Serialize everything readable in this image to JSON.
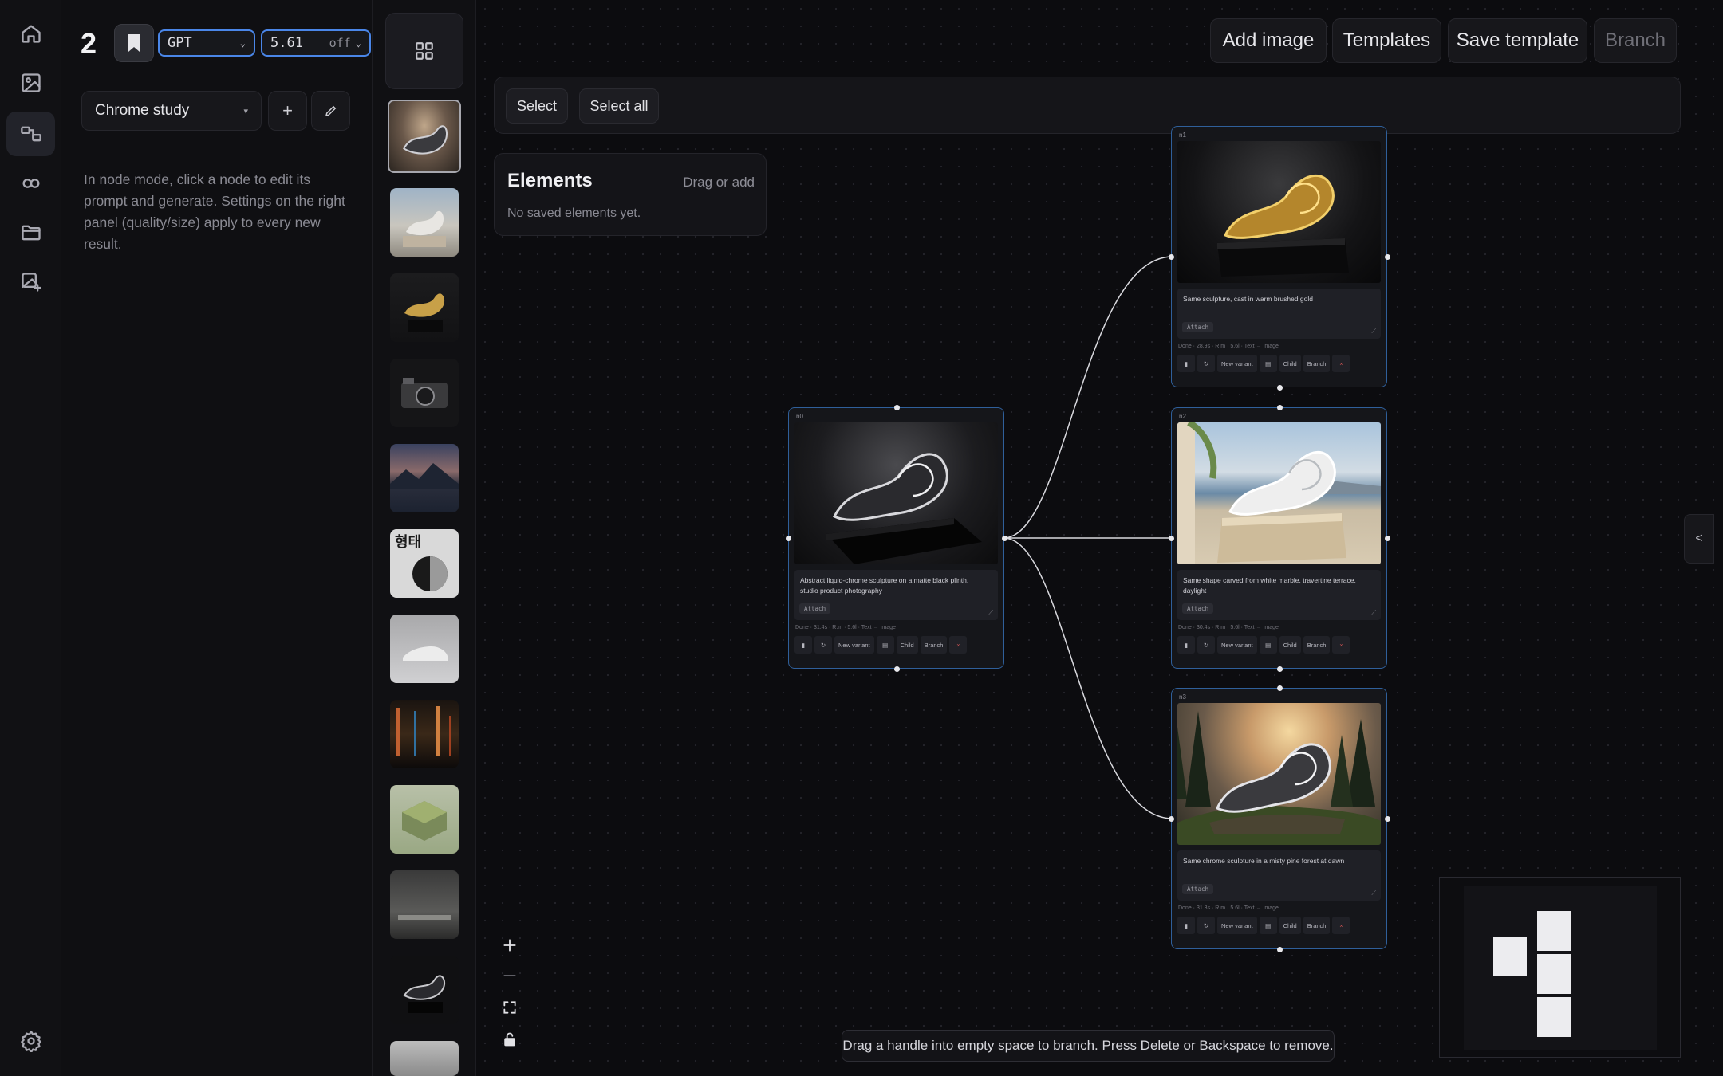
{
  "rail": {
    "items": [
      "home-icon",
      "image-icon",
      "nodes-icon",
      "community-icon",
      "folder-icon",
      "image-add-icon"
    ],
    "bottom": "settings-icon"
  },
  "panel": {
    "logo": "2",
    "model_select": "GPT",
    "version_select": "5.61",
    "version_suffix": "off",
    "project_name": "Chrome study",
    "add_label": "+",
    "hint": "In node mode, click a node to edit its prompt and generate. Settings on the right panel (quality/size) apply to every new result."
  },
  "toolbar": {
    "add_image": "Add image",
    "templates": "Templates",
    "save_template": "Save template",
    "branch": "Branch"
  },
  "selection": {
    "select": "Select",
    "select_all": "Select all"
  },
  "elements_panel": {
    "title": "Elements",
    "action": "Drag or add",
    "empty": "No saved elements yet."
  },
  "nodes": [
    {
      "id": "n0",
      "prompt": "Abstract liquid-chrome sculpture on a matte black plinth, studio product photography",
      "meta": "Done · 31.4s · R:m · 5.6l · Text → Image"
    },
    {
      "id": "n1",
      "prompt": "Same sculpture, cast in warm brushed gold",
      "meta": "Done · 28.9s · R:m · 5.6l · Text → Image"
    },
    {
      "id": "n2",
      "prompt": "Same shape carved from white marble, travertine terrace, daylight",
      "meta": "Done · 30.4s · R:m · 5.6l · Text → Image"
    },
    {
      "id": "n3",
      "prompt": "Same chrome sculpture in a misty pine forest at dawn",
      "meta": "Done · 31.3s · R:m · 5.6l · Text → Image"
    }
  ],
  "node_actions": {
    "attach": "Attach",
    "new_variant": "New variant",
    "child": "Child",
    "branch": "Branch",
    "delete": "×"
  },
  "toast": "Drag a handle into empty space to branch. Press Delete or Backspace to remove.",
  "collapse": "<",
  "thumb_text": "형태",
  "colors": {
    "accent": "#4a86e8",
    "node_border": "#2f5f9a",
    "background": "#0c0c0f"
  }
}
